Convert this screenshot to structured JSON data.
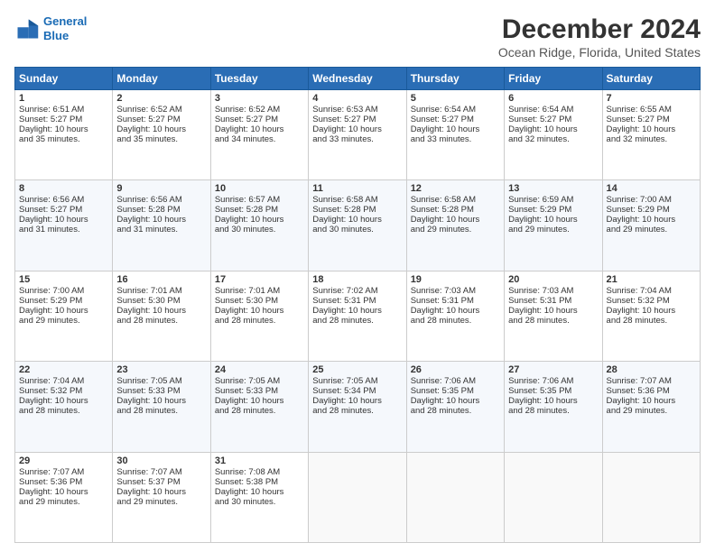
{
  "logo": {
    "line1": "General",
    "line2": "Blue"
  },
  "title": "December 2024",
  "subtitle": "Ocean Ridge, Florida, United States",
  "days_of_week": [
    "Sunday",
    "Monday",
    "Tuesday",
    "Wednesday",
    "Thursday",
    "Friday",
    "Saturday"
  ],
  "weeks": [
    [
      {
        "day": "1",
        "lines": [
          "Sunrise: 6:51 AM",
          "Sunset: 5:27 PM",
          "Daylight: 10 hours",
          "and 35 minutes."
        ]
      },
      {
        "day": "2",
        "lines": [
          "Sunrise: 6:52 AM",
          "Sunset: 5:27 PM",
          "Daylight: 10 hours",
          "and 35 minutes."
        ]
      },
      {
        "day": "3",
        "lines": [
          "Sunrise: 6:52 AM",
          "Sunset: 5:27 PM",
          "Daylight: 10 hours",
          "and 34 minutes."
        ]
      },
      {
        "day": "4",
        "lines": [
          "Sunrise: 6:53 AM",
          "Sunset: 5:27 PM",
          "Daylight: 10 hours",
          "and 33 minutes."
        ]
      },
      {
        "day": "5",
        "lines": [
          "Sunrise: 6:54 AM",
          "Sunset: 5:27 PM",
          "Daylight: 10 hours",
          "and 33 minutes."
        ]
      },
      {
        "day": "6",
        "lines": [
          "Sunrise: 6:54 AM",
          "Sunset: 5:27 PM",
          "Daylight: 10 hours",
          "and 32 minutes."
        ]
      },
      {
        "day": "7",
        "lines": [
          "Sunrise: 6:55 AM",
          "Sunset: 5:27 PM",
          "Daylight: 10 hours",
          "and 32 minutes."
        ]
      }
    ],
    [
      {
        "day": "8",
        "lines": [
          "Sunrise: 6:56 AM",
          "Sunset: 5:27 PM",
          "Daylight: 10 hours",
          "and 31 minutes."
        ]
      },
      {
        "day": "9",
        "lines": [
          "Sunrise: 6:56 AM",
          "Sunset: 5:28 PM",
          "Daylight: 10 hours",
          "and 31 minutes."
        ]
      },
      {
        "day": "10",
        "lines": [
          "Sunrise: 6:57 AM",
          "Sunset: 5:28 PM",
          "Daylight: 10 hours",
          "and 30 minutes."
        ]
      },
      {
        "day": "11",
        "lines": [
          "Sunrise: 6:58 AM",
          "Sunset: 5:28 PM",
          "Daylight: 10 hours",
          "and 30 minutes."
        ]
      },
      {
        "day": "12",
        "lines": [
          "Sunrise: 6:58 AM",
          "Sunset: 5:28 PM",
          "Daylight: 10 hours",
          "and 29 minutes."
        ]
      },
      {
        "day": "13",
        "lines": [
          "Sunrise: 6:59 AM",
          "Sunset: 5:29 PM",
          "Daylight: 10 hours",
          "and 29 minutes."
        ]
      },
      {
        "day": "14",
        "lines": [
          "Sunrise: 7:00 AM",
          "Sunset: 5:29 PM",
          "Daylight: 10 hours",
          "and 29 minutes."
        ]
      }
    ],
    [
      {
        "day": "15",
        "lines": [
          "Sunrise: 7:00 AM",
          "Sunset: 5:29 PM",
          "Daylight: 10 hours",
          "and 29 minutes."
        ]
      },
      {
        "day": "16",
        "lines": [
          "Sunrise: 7:01 AM",
          "Sunset: 5:30 PM",
          "Daylight: 10 hours",
          "and 28 minutes."
        ]
      },
      {
        "day": "17",
        "lines": [
          "Sunrise: 7:01 AM",
          "Sunset: 5:30 PM",
          "Daylight: 10 hours",
          "and 28 minutes."
        ]
      },
      {
        "day": "18",
        "lines": [
          "Sunrise: 7:02 AM",
          "Sunset: 5:31 PM",
          "Daylight: 10 hours",
          "and 28 minutes."
        ]
      },
      {
        "day": "19",
        "lines": [
          "Sunrise: 7:03 AM",
          "Sunset: 5:31 PM",
          "Daylight: 10 hours",
          "and 28 minutes."
        ]
      },
      {
        "day": "20",
        "lines": [
          "Sunrise: 7:03 AM",
          "Sunset: 5:31 PM",
          "Daylight: 10 hours",
          "and 28 minutes."
        ]
      },
      {
        "day": "21",
        "lines": [
          "Sunrise: 7:04 AM",
          "Sunset: 5:32 PM",
          "Daylight: 10 hours",
          "and 28 minutes."
        ]
      }
    ],
    [
      {
        "day": "22",
        "lines": [
          "Sunrise: 7:04 AM",
          "Sunset: 5:32 PM",
          "Daylight: 10 hours",
          "and 28 minutes."
        ]
      },
      {
        "day": "23",
        "lines": [
          "Sunrise: 7:05 AM",
          "Sunset: 5:33 PM",
          "Daylight: 10 hours",
          "and 28 minutes."
        ]
      },
      {
        "day": "24",
        "lines": [
          "Sunrise: 7:05 AM",
          "Sunset: 5:33 PM",
          "Daylight: 10 hours",
          "and 28 minutes."
        ]
      },
      {
        "day": "25",
        "lines": [
          "Sunrise: 7:05 AM",
          "Sunset: 5:34 PM",
          "Daylight: 10 hours",
          "and 28 minutes."
        ]
      },
      {
        "day": "26",
        "lines": [
          "Sunrise: 7:06 AM",
          "Sunset: 5:35 PM",
          "Daylight: 10 hours",
          "and 28 minutes."
        ]
      },
      {
        "day": "27",
        "lines": [
          "Sunrise: 7:06 AM",
          "Sunset: 5:35 PM",
          "Daylight: 10 hours",
          "and 28 minutes."
        ]
      },
      {
        "day": "28",
        "lines": [
          "Sunrise: 7:07 AM",
          "Sunset: 5:36 PM",
          "Daylight: 10 hours",
          "and 29 minutes."
        ]
      }
    ],
    [
      {
        "day": "29",
        "lines": [
          "Sunrise: 7:07 AM",
          "Sunset: 5:36 PM",
          "Daylight: 10 hours",
          "and 29 minutes."
        ]
      },
      {
        "day": "30",
        "lines": [
          "Sunrise: 7:07 AM",
          "Sunset: 5:37 PM",
          "Daylight: 10 hours",
          "and 29 minutes."
        ]
      },
      {
        "day": "31",
        "lines": [
          "Sunrise: 7:08 AM",
          "Sunset: 5:38 PM",
          "Daylight: 10 hours",
          "and 30 minutes."
        ]
      },
      null,
      null,
      null,
      null
    ]
  ]
}
